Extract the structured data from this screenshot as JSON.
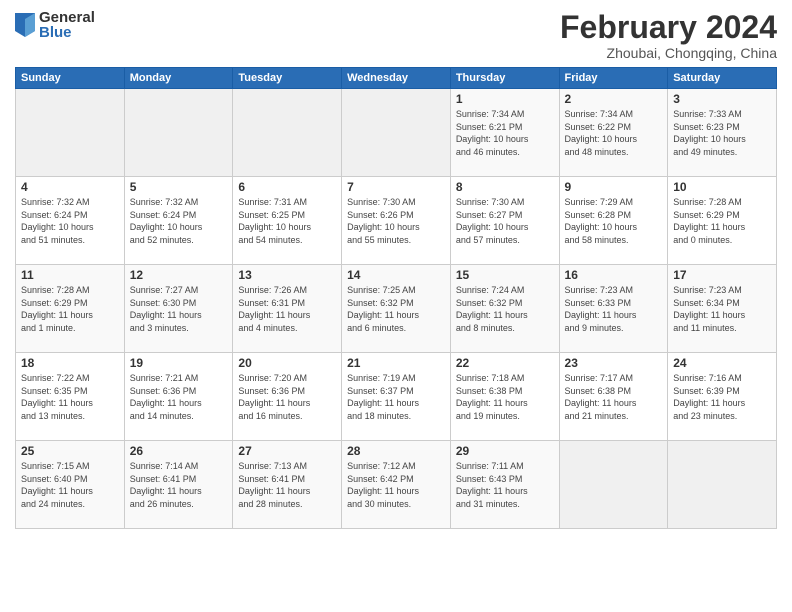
{
  "logo": {
    "general": "General",
    "blue": "Blue"
  },
  "header": {
    "month_year": "February 2024",
    "location": "Zhoubai, Chongqing, China"
  },
  "days": [
    "Sunday",
    "Monday",
    "Tuesday",
    "Wednesday",
    "Thursday",
    "Friday",
    "Saturday"
  ],
  "weeks": [
    [
      {
        "date": "",
        "info": ""
      },
      {
        "date": "",
        "info": ""
      },
      {
        "date": "",
        "info": ""
      },
      {
        "date": "",
        "info": ""
      },
      {
        "date": "1",
        "info": "Sunrise: 7:34 AM\nSunset: 6:21 PM\nDaylight: 10 hours\nand 46 minutes."
      },
      {
        "date": "2",
        "info": "Sunrise: 7:34 AM\nSunset: 6:22 PM\nDaylight: 10 hours\nand 48 minutes."
      },
      {
        "date": "3",
        "info": "Sunrise: 7:33 AM\nSunset: 6:23 PM\nDaylight: 10 hours\nand 49 minutes."
      }
    ],
    [
      {
        "date": "4",
        "info": "Sunrise: 7:32 AM\nSunset: 6:24 PM\nDaylight: 10 hours\nand 51 minutes."
      },
      {
        "date": "5",
        "info": "Sunrise: 7:32 AM\nSunset: 6:24 PM\nDaylight: 10 hours\nand 52 minutes."
      },
      {
        "date": "6",
        "info": "Sunrise: 7:31 AM\nSunset: 6:25 PM\nDaylight: 10 hours\nand 54 minutes."
      },
      {
        "date": "7",
        "info": "Sunrise: 7:30 AM\nSunset: 6:26 PM\nDaylight: 10 hours\nand 55 minutes."
      },
      {
        "date": "8",
        "info": "Sunrise: 7:30 AM\nSunset: 6:27 PM\nDaylight: 10 hours\nand 57 minutes."
      },
      {
        "date": "9",
        "info": "Sunrise: 7:29 AM\nSunset: 6:28 PM\nDaylight: 10 hours\nand 58 minutes."
      },
      {
        "date": "10",
        "info": "Sunrise: 7:28 AM\nSunset: 6:29 PM\nDaylight: 11 hours\nand 0 minutes."
      }
    ],
    [
      {
        "date": "11",
        "info": "Sunrise: 7:28 AM\nSunset: 6:29 PM\nDaylight: 11 hours\nand 1 minute."
      },
      {
        "date": "12",
        "info": "Sunrise: 7:27 AM\nSunset: 6:30 PM\nDaylight: 11 hours\nand 3 minutes."
      },
      {
        "date": "13",
        "info": "Sunrise: 7:26 AM\nSunset: 6:31 PM\nDaylight: 11 hours\nand 4 minutes."
      },
      {
        "date": "14",
        "info": "Sunrise: 7:25 AM\nSunset: 6:32 PM\nDaylight: 11 hours\nand 6 minutes."
      },
      {
        "date": "15",
        "info": "Sunrise: 7:24 AM\nSunset: 6:32 PM\nDaylight: 11 hours\nand 8 minutes."
      },
      {
        "date": "16",
        "info": "Sunrise: 7:23 AM\nSunset: 6:33 PM\nDaylight: 11 hours\nand 9 minutes."
      },
      {
        "date": "17",
        "info": "Sunrise: 7:23 AM\nSunset: 6:34 PM\nDaylight: 11 hours\nand 11 minutes."
      }
    ],
    [
      {
        "date": "18",
        "info": "Sunrise: 7:22 AM\nSunset: 6:35 PM\nDaylight: 11 hours\nand 13 minutes."
      },
      {
        "date": "19",
        "info": "Sunrise: 7:21 AM\nSunset: 6:36 PM\nDaylight: 11 hours\nand 14 minutes."
      },
      {
        "date": "20",
        "info": "Sunrise: 7:20 AM\nSunset: 6:36 PM\nDaylight: 11 hours\nand 16 minutes."
      },
      {
        "date": "21",
        "info": "Sunrise: 7:19 AM\nSunset: 6:37 PM\nDaylight: 11 hours\nand 18 minutes."
      },
      {
        "date": "22",
        "info": "Sunrise: 7:18 AM\nSunset: 6:38 PM\nDaylight: 11 hours\nand 19 minutes."
      },
      {
        "date": "23",
        "info": "Sunrise: 7:17 AM\nSunset: 6:38 PM\nDaylight: 11 hours\nand 21 minutes."
      },
      {
        "date": "24",
        "info": "Sunrise: 7:16 AM\nSunset: 6:39 PM\nDaylight: 11 hours\nand 23 minutes."
      }
    ],
    [
      {
        "date": "25",
        "info": "Sunrise: 7:15 AM\nSunset: 6:40 PM\nDaylight: 11 hours\nand 24 minutes."
      },
      {
        "date": "26",
        "info": "Sunrise: 7:14 AM\nSunset: 6:41 PM\nDaylight: 11 hours\nand 26 minutes."
      },
      {
        "date": "27",
        "info": "Sunrise: 7:13 AM\nSunset: 6:41 PM\nDaylight: 11 hours\nand 28 minutes."
      },
      {
        "date": "28",
        "info": "Sunrise: 7:12 AM\nSunset: 6:42 PM\nDaylight: 11 hours\nand 30 minutes."
      },
      {
        "date": "29",
        "info": "Sunrise: 7:11 AM\nSunset: 6:43 PM\nDaylight: 11 hours\nand 31 minutes."
      },
      {
        "date": "",
        "info": ""
      },
      {
        "date": "",
        "info": ""
      }
    ]
  ]
}
